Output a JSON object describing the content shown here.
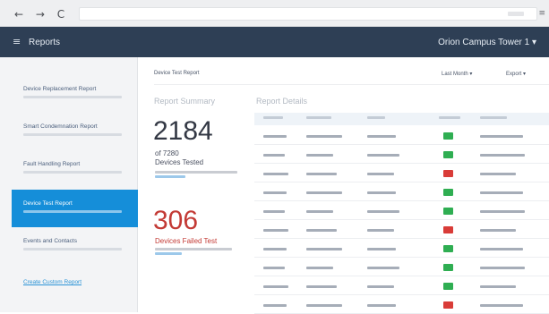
{
  "browser": {
    "nav_glyphs": "← → C",
    "menu_glyph": "≡"
  },
  "header": {
    "menu_icon": "≡",
    "title": "Reports",
    "site": "Orion Campus Tower 1 ▾"
  },
  "sidebar": {
    "items": [
      {
        "name": "device-replacement",
        "label": "Device Replacement Report",
        "active": false,
        "link": false
      },
      {
        "name": "smart-condemnation",
        "label": "Smart Condemnation Report",
        "active": false,
        "link": false
      },
      {
        "name": "fault-handling",
        "label": "Fault Handling Report",
        "active": false,
        "link": false
      },
      {
        "name": "device-test",
        "label": "Device Test Report",
        "active": true,
        "link": false
      },
      {
        "name": "events-and-contacts",
        "label": "Events and Contacts",
        "active": false,
        "link": false
      },
      {
        "name": "create-custom",
        "label": "Create Custom Report",
        "active": false,
        "link": true
      }
    ]
  },
  "main": {
    "breadcrumb": "Device Test Report",
    "filter_dropdown": "Last Month ▾",
    "export_dropdown": "Export ▾",
    "summary": {
      "title": "Report Summary",
      "tested_count": "2184",
      "tested_of": "of 7280",
      "tested_label": "Devices Tested",
      "failed_count": "306",
      "failed_label": "Devices Failed Test"
    },
    "results": {
      "title": "Report Details",
      "rows": [
        {
          "result": "pass"
        },
        {
          "result": "pass"
        },
        {
          "result": "fail"
        },
        {
          "result": "pass"
        },
        {
          "result": "pass"
        },
        {
          "result": "fail"
        },
        {
          "result": "pass"
        },
        {
          "result": "pass"
        },
        {
          "result": "pass"
        },
        {
          "result": "fail"
        }
      ]
    }
  },
  "colors": {
    "pass": "#2fae52",
    "fail": "#d93c38",
    "accent": "#158ed9",
    "header": "#2e3f55"
  }
}
